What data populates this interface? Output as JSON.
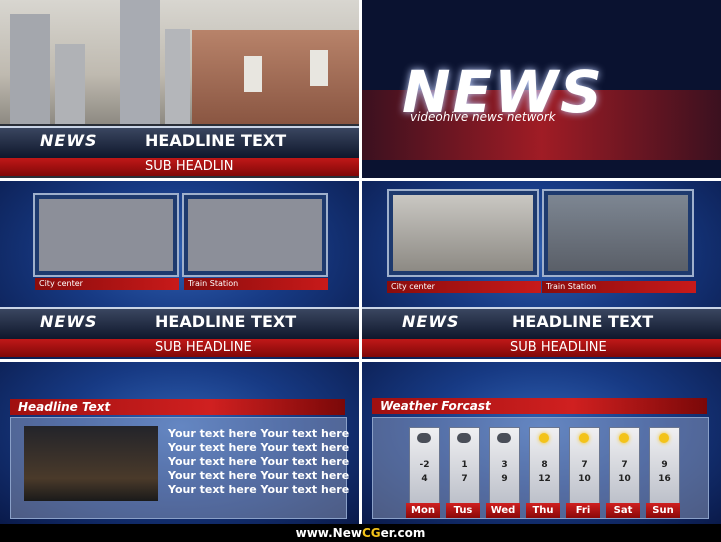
{
  "panel1": {
    "headline": "HEADLINE TEXT",
    "subheadline": "SUB HEADLIN",
    "logo": "NEWS"
  },
  "panel2": {
    "logo": "NEWS",
    "tagline": "videohive news network"
  },
  "panel3": {
    "captions": [
      "City center",
      "Train Station"
    ],
    "logo": "NEWS",
    "headline": "HEADLINE TEXT",
    "subheadline": "SUB HEADLINE"
  },
  "panel4": {
    "captions": [
      "City center",
      "Train Station"
    ],
    "logo": "NEWS",
    "headline": "HEADLINE TEXT",
    "subheadline": "SUB HEADLINE"
  },
  "panel5": {
    "title": "Headline Text",
    "lines": [
      "Your text here Your text here",
      "Your text here Your text here",
      "Your text here  Your text here",
      "Your text here Your text here",
      "Your text here Your text here"
    ]
  },
  "panel6": {
    "title": "Weather Forcast",
    "days": [
      {
        "name": "Mon",
        "hi": "-2",
        "lo": "4",
        "icon": "cloud-icon"
      },
      {
        "name": "Tus",
        "hi": "1",
        "lo": "7",
        "icon": "cloud-icon"
      },
      {
        "name": "Wed",
        "hi": "3",
        "lo": "9",
        "icon": "cloud-icon"
      },
      {
        "name": "Thu",
        "hi": "8",
        "lo": "12",
        "icon": "sun-icon"
      },
      {
        "name": "Fri",
        "hi": "7",
        "lo": "10",
        "icon": "sun-cloud-icon"
      },
      {
        "name": "Sat",
        "hi": "7",
        "lo": "10",
        "icon": "sun-cloud-icon"
      },
      {
        "name": "Sun",
        "hi": "9",
        "lo": "16",
        "icon": "sun-icon"
      }
    ]
  },
  "footer": {
    "prefix": "www.New",
    "accent": "CG",
    "suffix": "er.com"
  }
}
